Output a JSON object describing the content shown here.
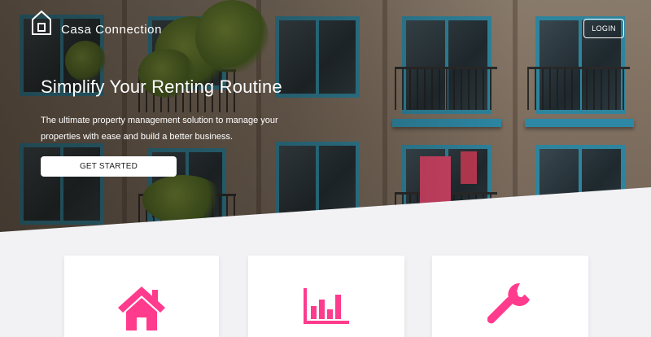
{
  "brand": {
    "name": "Casa Connection",
    "logo_icon": "house-outline-icon"
  },
  "nav": {
    "login_label": "LOGIN"
  },
  "hero": {
    "headline": "Simplify Your Renting Routine",
    "subline": "The ultimate property management solution to manage your properties with ease and build a better business.",
    "cta_label": "GET STARTED"
  },
  "features": [
    {
      "icon": "home-icon"
    },
    {
      "icon": "bar-chart-icon"
    },
    {
      "icon": "wrench-icon"
    }
  ],
  "colors": {
    "accent": "#ff3b8d",
    "frame_teal": "#2f8aa5",
    "background": "#f2f2f5"
  }
}
